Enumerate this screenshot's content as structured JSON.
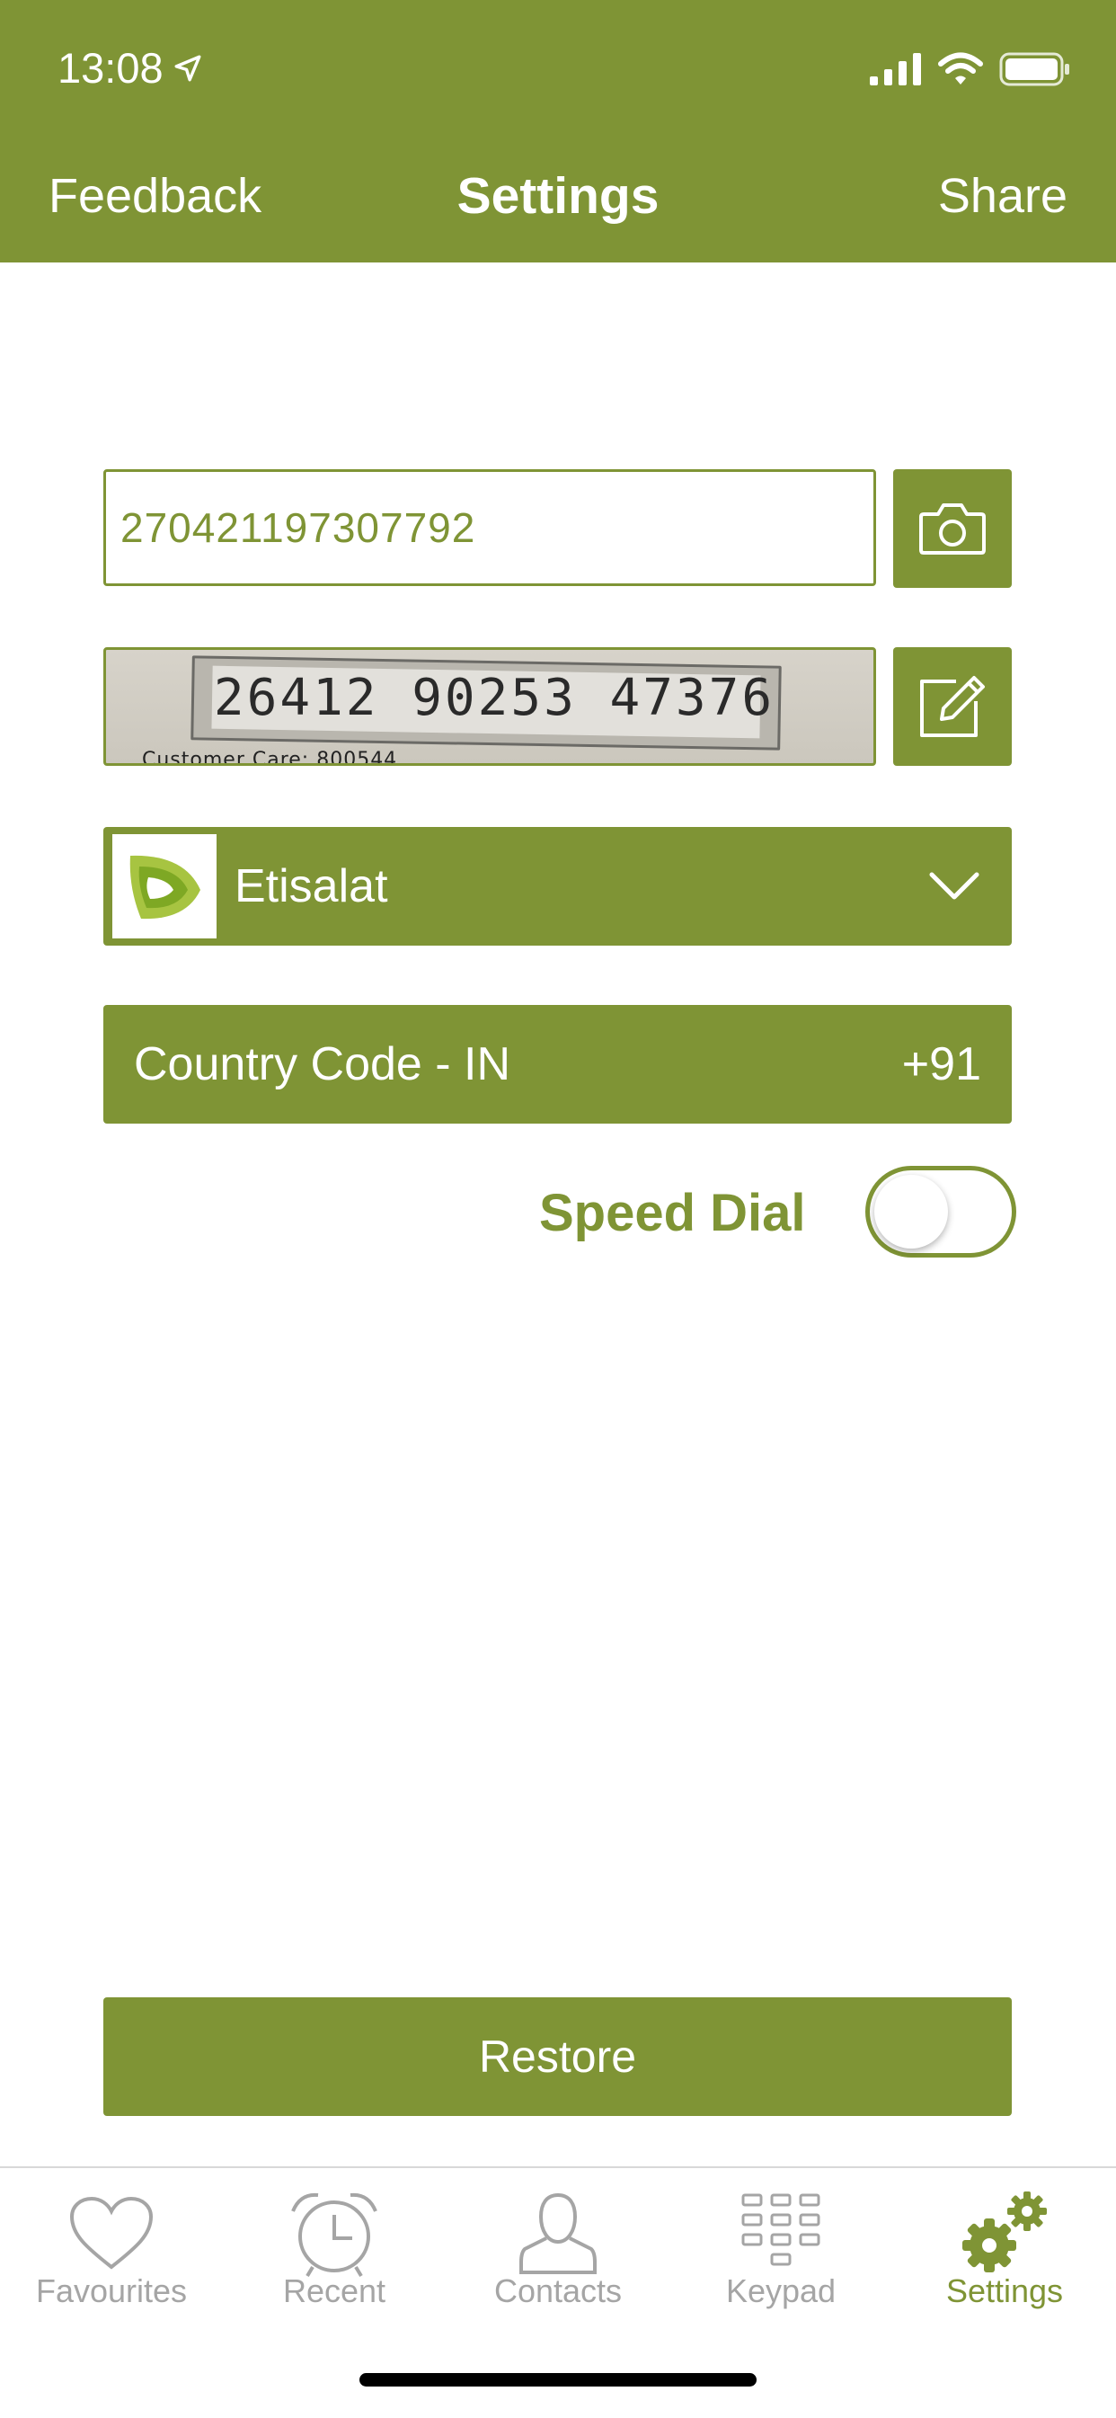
{
  "status_bar": {
    "time": "13:08"
  },
  "nav": {
    "left_label": "Feedback",
    "title": "Settings",
    "right_label": "Share"
  },
  "sim_number": {
    "value": "270421197307792"
  },
  "scan_photo": {
    "digits": "26412 90253 47376",
    "caption": "Customer Care: 800544"
  },
  "operator": {
    "name": "Etisalat"
  },
  "country": {
    "label": "Country Code - IN",
    "code": "+91"
  },
  "speed_dial": {
    "label": "Speed Dial",
    "enabled": false
  },
  "restore": {
    "label": "Restore"
  },
  "tabs": [
    {
      "label": "Favourites",
      "icon": "heart-icon",
      "active": false
    },
    {
      "label": "Recent",
      "icon": "alarm-clock-icon",
      "active": false
    },
    {
      "label": "Contacts",
      "icon": "person-icon",
      "active": false
    },
    {
      "label": "Keypad",
      "icon": "keypad-icon",
      "active": false
    },
    {
      "label": "Settings",
      "icon": "gears-icon",
      "active": true
    }
  ],
  "colors": {
    "accent": "#7f9435",
    "inactive": "#a5a5a5",
    "background": "#ffffff"
  }
}
